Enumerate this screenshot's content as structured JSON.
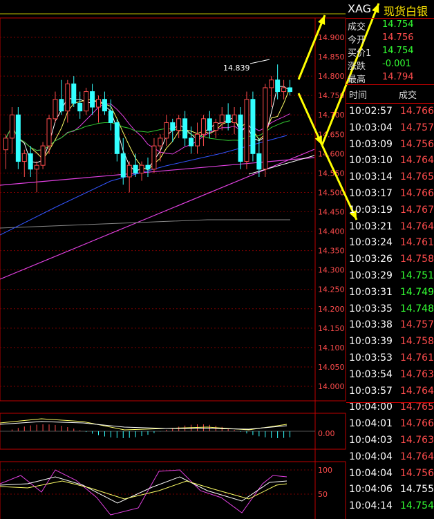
{
  "colors": {
    "up": "#ff4c4c",
    "down": "#33ff33",
    "axis": "#c00000",
    "ma_yellow": "#ffff66",
    "ma_magenta": "#e040e0",
    "ma_green": "#33cc33",
    "ma_blue": "#3355ff",
    "ma_gray": "#888888"
  },
  "quote": {
    "symbol": "XAG",
    "name": "现货白银",
    "rows": [
      {
        "label": "成交",
        "value": "14.754",
        "dir": "dn"
      },
      {
        "label": "今开",
        "value": "14.756",
        "dir": "up"
      },
      {
        "label": "买价1",
        "value": "14.754",
        "dir": "dn"
      },
      {
        "label": "涨跌",
        "value": "-0.001",
        "dir": "dn"
      },
      {
        "label": "最高",
        "value": "14.794",
        "dir": "up"
      }
    ]
  },
  "ticks_header": {
    "time": "时间",
    "price": "成交"
  },
  "ticks": [
    {
      "time": "10:02:57",
      "price": "14.766",
      "dir": "up"
    },
    {
      "time": "10:03:04",
      "price": "14.757",
      "dir": "up"
    },
    {
      "time": "10:03:09",
      "price": "14.756",
      "dir": "up"
    },
    {
      "time": "10:03:10",
      "price": "14.764",
      "dir": "up"
    },
    {
      "time": "10:03:14",
      "price": "14.765",
      "dir": "up"
    },
    {
      "time": "10:03:17",
      "price": "14.766",
      "dir": "up"
    },
    {
      "time": "10:03:19",
      "price": "14.767",
      "dir": "up"
    },
    {
      "time": "10:03:21",
      "price": "14.764",
      "dir": "up"
    },
    {
      "time": "10:03:24",
      "price": "14.761",
      "dir": "up"
    },
    {
      "time": "10:03:26",
      "price": "14.758",
      "dir": "up"
    },
    {
      "time": "10:03:29",
      "price": "14.751",
      "dir": "dn"
    },
    {
      "time": "10:03:31",
      "price": "14.749",
      "dir": "dn"
    },
    {
      "time": "10:03:35",
      "price": "14.748",
      "dir": "dn"
    },
    {
      "time": "10:03:38",
      "price": "14.757",
      "dir": "up"
    },
    {
      "time": "10:03:39",
      "price": "14.758",
      "dir": "up"
    },
    {
      "time": "10:03:53",
      "price": "14.761",
      "dir": "up"
    },
    {
      "time": "10:03:54",
      "price": "14.763",
      "dir": "up"
    },
    {
      "time": "10:03:57",
      "price": "14.764",
      "dir": "up"
    },
    {
      "time": "10:04:00",
      "price": "14.765",
      "dir": "up"
    },
    {
      "time": "10:04:01",
      "price": "14.766",
      "dir": "up"
    },
    {
      "time": "10:04:03",
      "price": "14.763",
      "dir": "up"
    },
    {
      "time": "10:04:04",
      "price": "14.764",
      "dir": "up"
    },
    {
      "time": "10:04:04",
      "price": "14.756",
      "dir": "up"
    },
    {
      "time": "10:04:06",
      "price": "14.755",
      "dir": "eq"
    },
    {
      "time": "10:04:14",
      "price": "14.754",
      "dir": "dn"
    }
  ],
  "chart_data": {
    "type": "candlestick",
    "y_axis_labels": [
      "14.900",
      "14.850",
      "14.800",
      "14.750",
      "14.700",
      "14.650",
      "14.600",
      "14.550",
      "14.500",
      "14.450",
      "14.400",
      "14.350",
      "14.300",
      "14.250",
      "14.200",
      "14.150",
      "14.100",
      "14.050",
      "14.000"
    ],
    "ylim": [
      14.0,
      14.9
    ],
    "high_annotation": "14.839",
    "macd_label": "0.00",
    "kdj_labels": [
      "100",
      "50"
    ],
    "candles": [
      [
        14.61,
        14.65,
        14.56,
        14.64
      ],
      [
        14.64,
        14.72,
        14.6,
        14.7
      ],
      [
        14.7,
        14.72,
        14.56,
        14.58
      ],
      [
        14.58,
        14.61,
        14.54,
        14.6
      ],
      [
        14.6,
        14.62,
        14.54,
        14.56
      ],
      [
        14.56,
        14.58,
        14.5,
        14.57
      ],
      [
        14.57,
        14.63,
        14.56,
        14.62
      ],
      [
        14.62,
        14.7,
        14.6,
        14.69
      ],
      [
        14.69,
        14.76,
        14.68,
        14.74
      ],
      [
        14.74,
        14.79,
        14.7,
        14.71
      ],
      [
        14.71,
        14.79,
        14.68,
        14.78
      ],
      [
        14.78,
        14.8,
        14.72,
        14.73
      ],
      [
        14.73,
        14.76,
        14.69,
        14.71
      ],
      [
        14.71,
        14.77,
        14.7,
        14.76
      ],
      [
        14.76,
        14.78,
        14.7,
        14.72
      ],
      [
        14.72,
        14.75,
        14.68,
        14.74
      ],
      [
        14.74,
        14.76,
        14.7,
        14.71
      ],
      [
        14.71,
        14.74,
        14.66,
        14.68
      ],
      [
        14.68,
        14.69,
        14.58,
        14.6
      ],
      [
        14.6,
        14.64,
        14.52,
        14.54
      ],
      [
        14.54,
        14.58,
        14.5,
        14.57
      ],
      [
        14.57,
        14.6,
        14.54,
        14.55
      ],
      [
        14.55,
        14.58,
        14.53,
        14.57
      ],
      [
        14.57,
        14.59,
        14.54,
        14.56
      ],
      [
        14.56,
        14.64,
        14.55,
        14.62
      ],
      [
        14.62,
        14.65,
        14.58,
        14.64
      ],
      [
        14.64,
        14.7,
        14.62,
        14.68
      ],
      [
        14.68,
        14.69,
        14.63,
        14.66
      ],
      [
        14.66,
        14.7,
        14.64,
        14.69
      ],
      [
        14.69,
        14.71,
        14.62,
        14.64
      ],
      [
        14.64,
        14.67,
        14.6,
        14.62
      ],
      [
        14.62,
        14.68,
        14.6,
        14.65
      ],
      [
        14.65,
        14.7,
        14.62,
        14.69
      ],
      [
        14.69,
        14.71,
        14.64,
        14.66
      ],
      [
        14.66,
        14.69,
        14.64,
        14.68
      ],
      [
        14.68,
        14.72,
        14.66,
        14.7
      ],
      [
        14.7,
        14.73,
        14.66,
        14.68
      ],
      [
        14.68,
        14.72,
        14.65,
        14.7
      ],
      [
        14.7,
        14.72,
        14.56,
        14.58
      ],
      [
        14.58,
        14.76,
        14.56,
        14.74
      ],
      [
        14.74,
        14.76,
        14.58,
        14.6
      ],
      [
        14.6,
        14.64,
        14.54,
        14.56
      ],
      [
        14.56,
        14.78,
        14.54,
        14.77
      ],
      [
        14.77,
        14.8,
        14.72,
        14.79
      ],
      [
        14.79,
        14.83,
        14.74,
        14.76
      ],
      [
        14.76,
        14.79,
        14.74,
        14.77
      ],
      [
        14.77,
        14.79,
        14.75,
        14.76
      ]
    ]
  }
}
